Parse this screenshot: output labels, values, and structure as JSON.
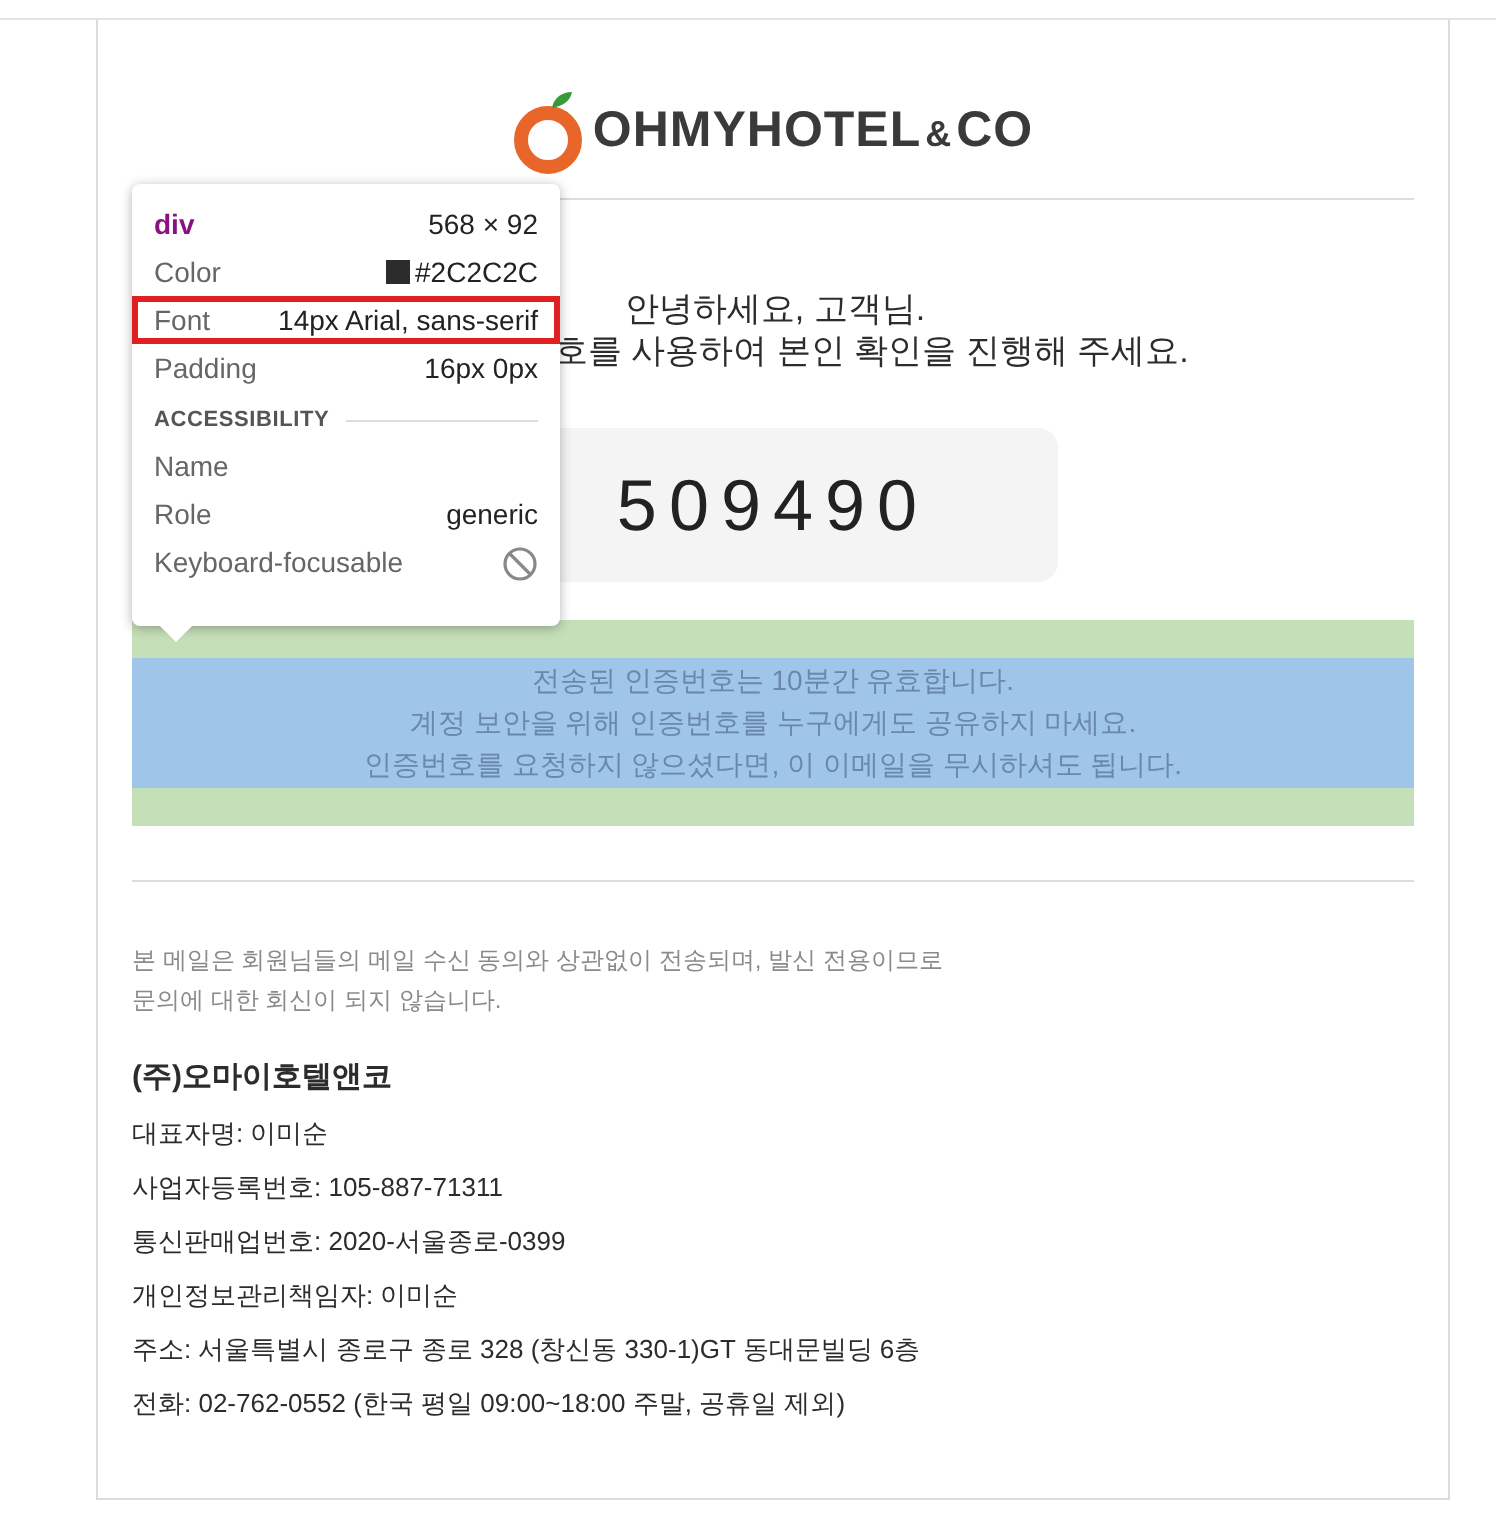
{
  "logo": {
    "name": "OHMYHOTEL",
    "ampersand": "&",
    "suffix": "CO"
  },
  "greeting": {
    "line_1": "안녕하세요, 고객님.",
    "line_2": "호를 사용하여 본인 확인을 진행해 주세요."
  },
  "verification_code": "509490",
  "notice": [
    "전송된 인증번호는 10분간 유효합니다.",
    "계정 보안을 위해 인증번호를 누구에게도 공유하지 마세요.",
    "인증번호를 요청하지 않으셨다면, 이 이메일을 무시하셔도 됩니다."
  ],
  "footer": {
    "disclaimer": [
      "본 메일은 회원님들의 메일 수신 동의와 상관없이 전송되며, 발신 전용이므로",
      "문의에 대한 회신이 되지 않습니다."
    ],
    "company": "(주)오마이호텔앤코",
    "details": [
      "대표자명: 이미순",
      "사업자등록번호: 105-887-71311",
      "통신판매업번호: 2020-서울종로-0399",
      "개인정보관리책임자: 이미순",
      "주소: 서울특별시 종로구 종로 328 (창신동 330-1)GT 동대문빌딩 6층",
      "전화: 02-762-0552 (한국 평일 09:00~18:00 주말, 공휴일 제외)"
    ]
  },
  "inspector_tooltip": {
    "tag": "div",
    "size": "568 × 92",
    "rows": [
      {
        "kind": "swatch",
        "label": "Color",
        "value": "#2C2C2C",
        "highlighted": false
      },
      {
        "kind": "text",
        "label": "Font",
        "value": "14px Arial, sans-serif",
        "highlighted": true
      },
      {
        "kind": "text",
        "label": "Padding",
        "value": "16px 0px",
        "highlighted": false
      }
    ],
    "section": "ACCESSIBILITY",
    "accessibility": [
      {
        "kind": "empty",
        "label": "Name"
      },
      {
        "kind": "text",
        "label": "Role",
        "value": "generic"
      },
      {
        "kind": "blocked",
        "label": "Keyboard-focusable"
      }
    ]
  }
}
